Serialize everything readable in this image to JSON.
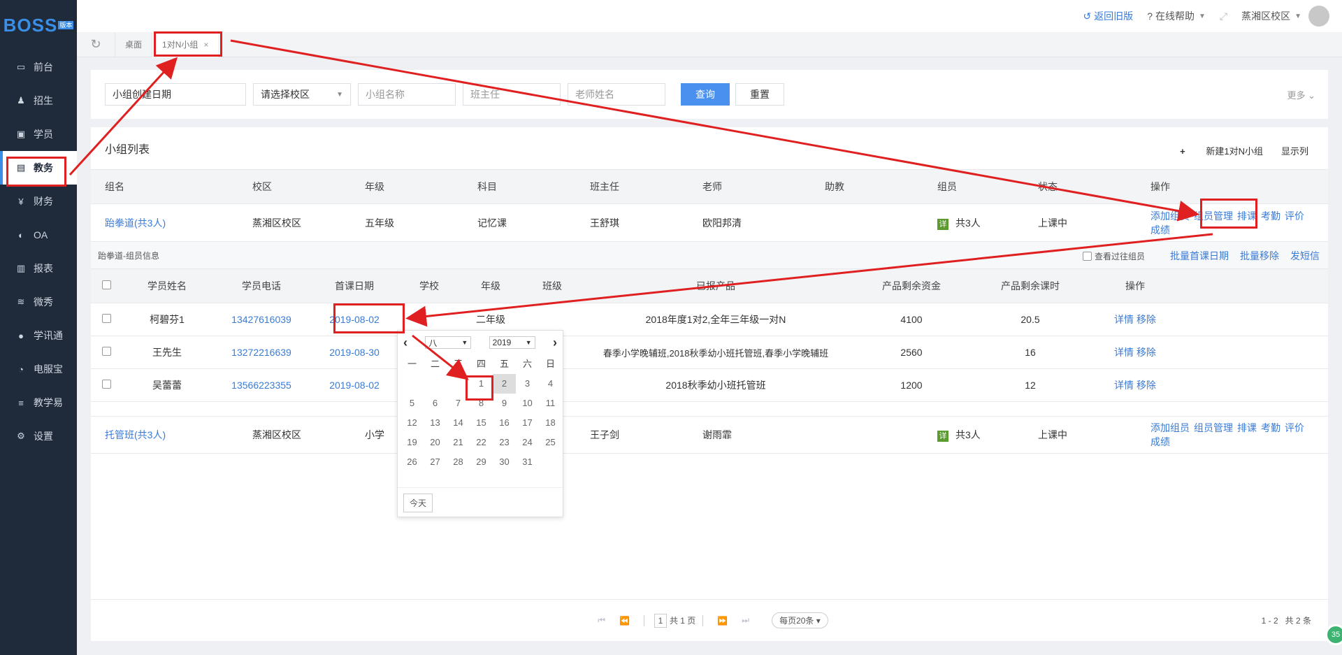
{
  "logo": {
    "text": "BOSS",
    "badge": "版本"
  },
  "sidebar": {
    "items": [
      {
        "label": "前台",
        "icon": "calendar-icon"
      },
      {
        "label": "招生",
        "icon": "user-plus-icon"
      },
      {
        "label": "学员",
        "icon": "id-card-icon"
      },
      {
        "label": "教务",
        "icon": "book-icon",
        "active": true
      },
      {
        "label": "财务",
        "icon": "yen-icon"
      },
      {
        "label": "OA",
        "icon": "toggle-icon"
      },
      {
        "label": "报表",
        "icon": "bar-chart-icon"
      },
      {
        "label": "微秀",
        "icon": "wave-icon"
      },
      {
        "label": "学讯通",
        "icon": "location-icon"
      },
      {
        "label": "电服宝",
        "icon": "phone-icon"
      },
      {
        "label": "教学易",
        "icon": "teach-icon"
      },
      {
        "label": "设置",
        "icon": "gear-icon"
      }
    ]
  },
  "header": {
    "back_label": "返回旧版",
    "help_label": "在线帮助",
    "campus_label": "蒸湘区校区"
  },
  "tabs": [
    {
      "label": "桌面"
    },
    {
      "label": "1对N小组",
      "close": "×",
      "active": true
    }
  ],
  "search": {
    "date_value": "小组创建日期",
    "campus_placeholder": "请选择校区",
    "group_name_placeholder": "小组名称",
    "head_teacher_placeholder": "班主任",
    "teacher_placeholder": "老师姓名",
    "query_label": "查询",
    "reset_label": "重置",
    "more_label": "更多"
  },
  "group_list": {
    "title": "小组列表",
    "new_label": "新建1对N小组",
    "columns_label": "显示列",
    "columns": [
      "组名",
      "校区",
      "年级",
      "科目",
      "班主任",
      "老师",
      "助教",
      "组员",
      "状态",
      "操作"
    ],
    "rows": [
      {
        "name": "跆拳道(共3人)",
        "campus": "蒸湘区校区",
        "grade": "五年级",
        "subject": "记忆课",
        "head_teacher": "王舒琪",
        "teacher": "欧阳邦清",
        "assistant": "",
        "badge": "详",
        "members": "共3人",
        "status": "上课中",
        "ops": [
          "添加组员",
          "组员管理",
          "排课",
          "考勤",
          "评价",
          "成绩"
        ]
      },
      {
        "name": "托管班(共3人)",
        "campus": "蒸湘区校区",
        "grade": "小学",
        "subject": "",
        "head_teacher": "王子剑",
        "teacher": "谢雨霏",
        "assistant": "",
        "badge": "详",
        "members": "共3人",
        "status": "上课中",
        "ops": [
          "添加组员",
          "组员管理",
          "排课",
          "考勤",
          "评价",
          "成绩"
        ]
      }
    ]
  },
  "members": {
    "title": "跆拳道-组员信息",
    "history_label": "查看过往组员",
    "batch_date_label": "批量首课日期",
    "batch_remove_label": "批量移除",
    "sms_label": "发短信",
    "columns": [
      "",
      "学员姓名",
      "学员电话",
      "首课日期",
      "学校",
      "年级",
      "班级",
      "已报产品",
      "产品剩余资金",
      "产品剩余课时",
      "操作"
    ],
    "rows": [
      {
        "name": "柯碧芬1",
        "phone": "13427616039",
        "first_date": "2019-08-02",
        "school": "",
        "grade": "二年级",
        "class": "",
        "product": "2018年度1对2,全年三年级一对N",
        "funds": "4100",
        "hours": "20.5"
      },
      {
        "name": "王先生",
        "phone": "13272216639",
        "first_date": "2019-08-30",
        "school": "",
        "grade": "",
        "class": "",
        "product": "春季小学晚辅班,2018秋季幼小班托管班,春季小学晚辅班",
        "funds": "2560",
        "hours": "16"
      },
      {
        "name": "吴蕾蕾",
        "phone": "13566223355",
        "first_date": "2019-08-02",
        "school": "",
        "grade": "",
        "class": "",
        "product": "2018秋季幼小班托管班",
        "funds": "1200",
        "hours": "12"
      }
    ],
    "op_detail": "详情",
    "op_remove": "移除"
  },
  "calendar": {
    "month": "八",
    "year": "2019",
    "weekdays": [
      "一",
      "二",
      "三",
      "四",
      "五",
      "六",
      "日"
    ],
    "days": [
      "",
      "",
      "",
      "1",
      "2",
      "3",
      "4",
      "5",
      "6",
      "7",
      "8",
      "9",
      "10",
      "11",
      "12",
      "13",
      "14",
      "15",
      "16",
      "17",
      "18",
      "19",
      "20",
      "21",
      "22",
      "23",
      "24",
      "25",
      "26",
      "27",
      "28",
      "29",
      "30",
      "31"
    ],
    "selected": "2",
    "today_label": "今天"
  },
  "pager": {
    "page": "1",
    "total_pages": "共 1 页",
    "page_size": "每页20条",
    "range": "1 - 2",
    "total": "共 2 条"
  },
  "float_badge": "35",
  "annotation_color": "#e02020"
}
